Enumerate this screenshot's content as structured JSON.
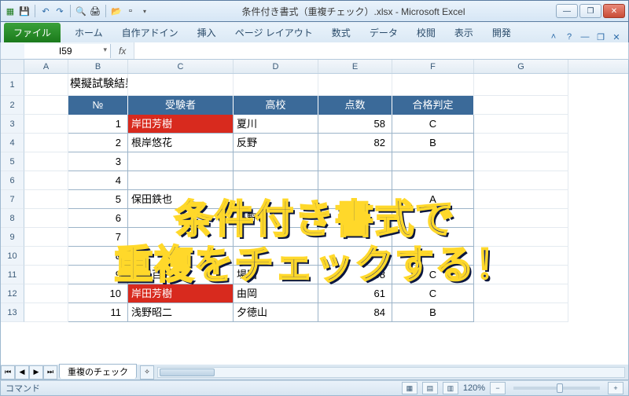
{
  "window": {
    "title": "条件付き書式（重複チェック）.xlsx - Microsoft Excel"
  },
  "ribbon": {
    "file": "ファイル",
    "tabs": [
      "ホーム",
      "自作アドイン",
      "挿入",
      "ページ レイアウト",
      "数式",
      "データ",
      "校閲",
      "表示",
      "開発"
    ]
  },
  "namebox": "I59",
  "columns": [
    "A",
    "B",
    "C",
    "D",
    "E",
    "F",
    "G"
  ],
  "row_numbers": [
    1,
    2,
    3,
    4,
    5,
    6,
    7,
    8,
    9,
    10,
    11,
    12,
    13
  ],
  "table": {
    "title": "模擬試験結果",
    "headers": {
      "no": "№",
      "examinee": "受験者",
      "school": "高校",
      "score": "点数",
      "result": "合格判定"
    },
    "rows": [
      {
        "no": 1,
        "examinee": "岸田芳樹",
        "school": "夏川",
        "score": 58,
        "result": "C",
        "dup": true
      },
      {
        "no": 2,
        "examinee": "根岸悠花",
        "school": "反野",
        "score": 82,
        "result": "B",
        "dup": false
      },
      {
        "no": 3,
        "examinee": "",
        "school": "",
        "score": "",
        "result": "",
        "dup": false
      },
      {
        "no": 4,
        "examinee": "",
        "school": "",
        "score": "",
        "result": "",
        "dup": false
      },
      {
        "no": 5,
        "examinee": "保田鉄也",
        "school": "",
        "score": "",
        "result": "A",
        "dup": false
      },
      {
        "no": 6,
        "examinee": "",
        "school": "丹野",
        "score": "",
        "result": "",
        "dup": false
      },
      {
        "no": 7,
        "examinee": "",
        "school": "",
        "score": "",
        "result": "",
        "dup": false
      },
      {
        "no": 8,
        "examinee": "",
        "school": "",
        "score": "",
        "result": "",
        "dup": false
      },
      {
        "no": 9,
        "examinee": "真鍋百合",
        "school": "場田",
        "score": 68,
        "result": "C",
        "dup": false
      },
      {
        "no": 10,
        "examinee": "岸田芳樹",
        "school": "由岡",
        "score": 61,
        "result": "C",
        "dup": true
      },
      {
        "no": 11,
        "examinee": "浅野昭二",
        "school": "夕徳山",
        "score": 84,
        "result": "B",
        "dup": false
      }
    ]
  },
  "sheet_tab": "重複のチェック",
  "status": {
    "mode": "コマンド",
    "zoom": "120%"
  },
  "overlay": {
    "line1": "条件付き書式で",
    "line2": "重複をチェックする！"
  }
}
